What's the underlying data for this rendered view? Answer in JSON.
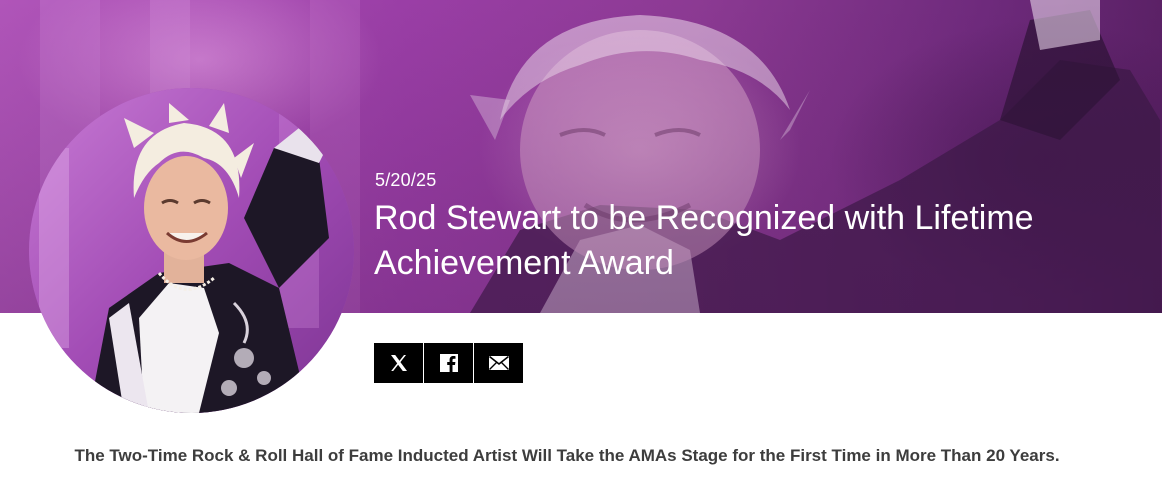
{
  "article": {
    "date": "5/20/25",
    "title": "Rod Stewart to be Recognized with Lifetime Achievement Award",
    "subheadline": "The Two-Time Rock & Roll Hall of Fame Inducted Artist Will Take the AMAs Stage for the First Time in More Than 20 Years."
  },
  "share": {
    "buttons": [
      {
        "network": "X",
        "icon": "x-logo-icon"
      },
      {
        "network": "Facebook",
        "icon": "facebook-icon"
      },
      {
        "network": "Email",
        "icon": "envelope-icon"
      }
    ]
  },
  "colors": {
    "hero_purple": "#9a3ea6",
    "button_bg": "#000000",
    "subhead_text": "#3d3d3d"
  }
}
